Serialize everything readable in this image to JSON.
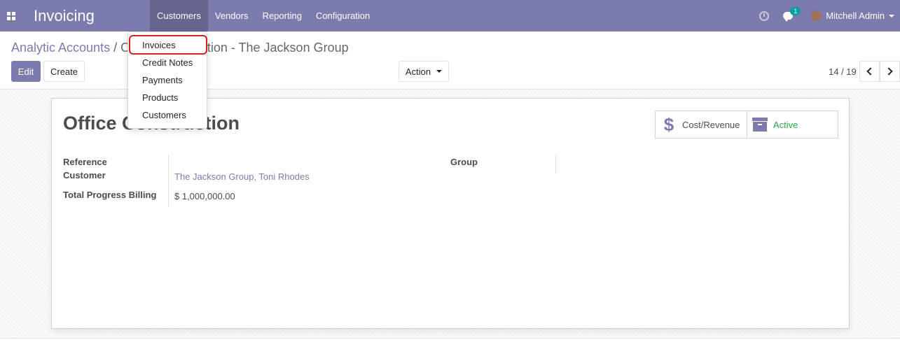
{
  "navbar": {
    "app_title": "Invoicing",
    "menu": [
      "Customers",
      "Vendors",
      "Reporting",
      "Configuration"
    ],
    "active_menu": "Customers",
    "chat_badge": "1",
    "user_name": "Mitchell Admin",
    "icons": [
      "apps-icon",
      "clock-icon",
      "chat-icon",
      "avatar",
      "caret-down-icon"
    ]
  },
  "breadcrumb": {
    "parent": "Analytic Accounts",
    "separator": "/",
    "current": "Office Construction - The Jackson Group"
  },
  "buttons": {
    "edit": "Edit",
    "create": "Create",
    "action": "Action"
  },
  "pager": {
    "text": "14 / 19"
  },
  "dropdown": {
    "items": [
      "Invoices",
      "Credit Notes",
      "Payments",
      "Products",
      "Customers"
    ],
    "highlighted": "Invoices"
  },
  "record": {
    "title": "Office Construction",
    "stat_buttons": [
      {
        "label": "Cost/Revenue",
        "icon": "dollar-icon"
      },
      {
        "label": "Active",
        "icon": "archive-icon",
        "color": "#28a745"
      }
    ],
    "fields": {
      "reference_label": "Reference",
      "customer_label": "Customer",
      "customer_value": "The Jackson Group, Toni Rhodes",
      "billing_label": "Total Progress Billing",
      "billing_value": "$ 1,000,000.00",
      "group_label": "Group"
    }
  },
  "colors": {
    "brand": "#7c7bad",
    "highlight_border": "#d62020",
    "active_green": "#28a745",
    "badge": "#00a09d"
  }
}
